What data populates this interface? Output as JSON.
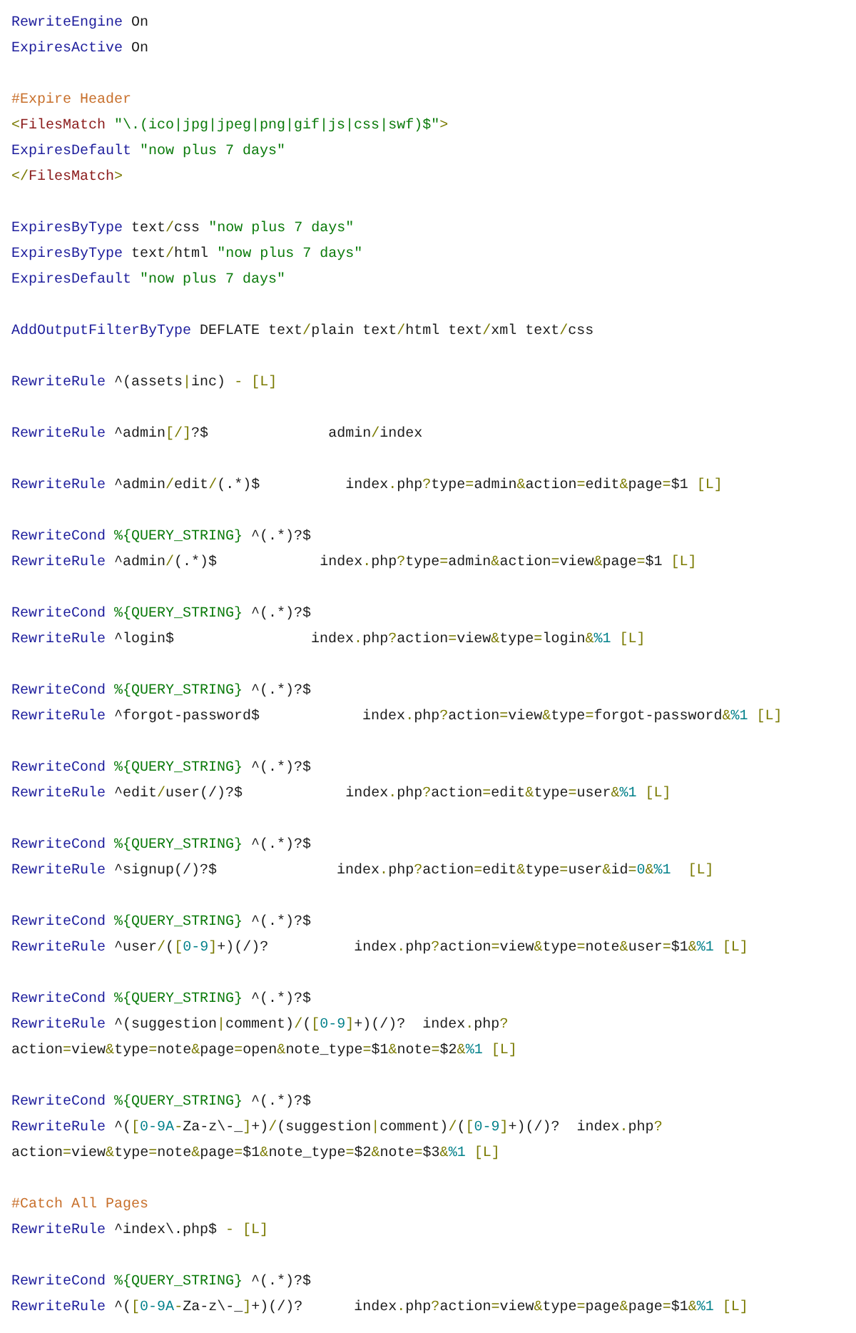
{
  "blocks": [
    {
      "lines": [
        {
          "tokens": [
            {
              "kind": "directive",
              "text": "RewriteEngine"
            },
            {
              "kind": "plain",
              "text": " On"
            }
          ]
        },
        {
          "tokens": [
            {
              "kind": "directive",
              "text": "ExpiresActive"
            },
            {
              "kind": "plain",
              "text": " On"
            }
          ]
        }
      ]
    },
    {
      "lines": [
        {
          "tokens": [
            {
              "kind": "comment",
              "text": "#Expire Header"
            }
          ]
        },
        {
          "tokens": [
            {
              "kind": "tag",
              "text": "<"
            },
            {
              "kind": "tagname",
              "text": "FilesMatch"
            },
            {
              "kind": "string",
              "text": " \"\\.(ico|jpg|jpeg|png|gif|js|css|swf)$\""
            },
            {
              "kind": "tag",
              "text": ">"
            }
          ]
        },
        {
          "tokens": [
            {
              "kind": "directive",
              "text": "ExpiresDefault"
            },
            {
              "kind": "string",
              "text": " \"now plus 7 days\""
            }
          ]
        },
        {
          "tokens": [
            {
              "kind": "tag",
              "text": "</"
            },
            {
              "kind": "tagname",
              "text": "FilesMatch"
            },
            {
              "kind": "tag",
              "text": ">"
            }
          ]
        }
      ]
    },
    {
      "lines": [
        {
          "tokens": [
            {
              "kind": "directive",
              "text": "ExpiresByType"
            },
            {
              "kind": "plain",
              "text": " text"
            },
            {
              "kind": "op",
              "text": "/"
            },
            {
              "kind": "plain",
              "text": "css"
            },
            {
              "kind": "string",
              "text": " \"now plus 7 days\""
            }
          ]
        },
        {
          "tokens": [
            {
              "kind": "directive",
              "text": "ExpiresByType"
            },
            {
              "kind": "plain",
              "text": " text"
            },
            {
              "kind": "op",
              "text": "/"
            },
            {
              "kind": "plain",
              "text": "html"
            },
            {
              "kind": "string",
              "text": " \"now plus 7 days\""
            }
          ]
        },
        {
          "tokens": [
            {
              "kind": "directive",
              "text": "ExpiresDefault"
            },
            {
              "kind": "string",
              "text": " \"now plus 7 days\""
            }
          ]
        }
      ]
    },
    {
      "lines": [
        {
          "tokens": [
            {
              "kind": "directive",
              "text": "AddOutputFilterByType"
            },
            {
              "kind": "plain",
              "text": " DEFLATE text"
            },
            {
              "kind": "op",
              "text": "/"
            },
            {
              "kind": "plain",
              "text": "plain text"
            },
            {
              "kind": "op",
              "text": "/"
            },
            {
              "kind": "plain",
              "text": "html text"
            },
            {
              "kind": "op",
              "text": "/"
            },
            {
              "kind": "plain",
              "text": "xml text"
            },
            {
              "kind": "op",
              "text": "/"
            },
            {
              "kind": "plain",
              "text": "css"
            }
          ]
        }
      ]
    },
    {
      "lines": [
        {
          "tokens": [
            {
              "kind": "directive",
              "text": "RewriteRule"
            },
            {
              "kind": "plain",
              "text": " ^(assets"
            },
            {
              "kind": "op",
              "text": "|"
            },
            {
              "kind": "plain",
              "text": "inc)"
            },
            {
              "kind": "op",
              "text": " - [L]"
            }
          ]
        }
      ]
    },
    {
      "lines": [
        {
          "tokens": [
            {
              "kind": "directive",
              "text": "RewriteRule"
            },
            {
              "kind": "plain",
              "text": " ^admin"
            },
            {
              "kind": "op",
              "text": "[/]"
            },
            {
              "kind": "plain",
              "text": "?$              admin"
            },
            {
              "kind": "op",
              "text": "/"
            },
            {
              "kind": "plain",
              "text": "index"
            }
          ]
        }
      ]
    },
    {
      "lines": [
        {
          "tokens": [
            {
              "kind": "directive",
              "text": "RewriteRule"
            },
            {
              "kind": "plain",
              "text": " ^admin"
            },
            {
              "kind": "op",
              "text": "/"
            },
            {
              "kind": "plain",
              "text": "edit"
            },
            {
              "kind": "op",
              "text": "/"
            },
            {
              "kind": "plain",
              "text": "(.*)$          index"
            },
            {
              "kind": "op",
              "text": "."
            },
            {
              "kind": "plain",
              "text": "php"
            },
            {
              "kind": "op",
              "text": "?"
            },
            {
              "kind": "plain",
              "text": "type"
            },
            {
              "kind": "op",
              "text": "="
            },
            {
              "kind": "plain",
              "text": "admin"
            },
            {
              "kind": "op",
              "text": "&"
            },
            {
              "kind": "plain",
              "text": "action"
            },
            {
              "kind": "op",
              "text": "="
            },
            {
              "kind": "plain",
              "text": "edit"
            },
            {
              "kind": "op",
              "text": "&"
            },
            {
              "kind": "plain",
              "text": "page"
            },
            {
              "kind": "op",
              "text": "="
            },
            {
              "kind": "plain",
              "text": "$1"
            },
            {
              "kind": "op",
              "text": " [L]"
            }
          ]
        }
      ]
    },
    {
      "lines": [
        {
          "tokens": [
            {
              "kind": "directive",
              "text": "RewriteCond"
            },
            {
              "kind": "string",
              "text": " %{QUERY_STRING}"
            },
            {
              "kind": "plain",
              "text": " ^(.*)?$"
            }
          ]
        },
        {
          "tokens": [
            {
              "kind": "directive",
              "text": "RewriteRule"
            },
            {
              "kind": "plain",
              "text": " ^admin"
            },
            {
              "kind": "op",
              "text": "/"
            },
            {
              "kind": "plain",
              "text": "(.*)$            index"
            },
            {
              "kind": "op",
              "text": "."
            },
            {
              "kind": "plain",
              "text": "php"
            },
            {
              "kind": "op",
              "text": "?"
            },
            {
              "kind": "plain",
              "text": "type"
            },
            {
              "kind": "op",
              "text": "="
            },
            {
              "kind": "plain",
              "text": "admin"
            },
            {
              "kind": "op",
              "text": "&"
            },
            {
              "kind": "plain",
              "text": "action"
            },
            {
              "kind": "op",
              "text": "="
            },
            {
              "kind": "plain",
              "text": "view"
            },
            {
              "kind": "op",
              "text": "&"
            },
            {
              "kind": "plain",
              "text": "page"
            },
            {
              "kind": "op",
              "text": "="
            },
            {
              "kind": "plain",
              "text": "$1"
            },
            {
              "kind": "op",
              "text": " [L]"
            }
          ]
        }
      ]
    },
    {
      "lines": [
        {
          "tokens": [
            {
              "kind": "directive",
              "text": "RewriteCond"
            },
            {
              "kind": "string",
              "text": " %{QUERY_STRING}"
            },
            {
              "kind": "plain",
              "text": " ^(.*)?$"
            }
          ]
        },
        {
          "tokens": [
            {
              "kind": "directive",
              "text": "RewriteRule"
            },
            {
              "kind": "plain",
              "text": " ^login$                index"
            },
            {
              "kind": "op",
              "text": "."
            },
            {
              "kind": "plain",
              "text": "php"
            },
            {
              "kind": "op",
              "text": "?"
            },
            {
              "kind": "plain",
              "text": "action"
            },
            {
              "kind": "op",
              "text": "="
            },
            {
              "kind": "plain",
              "text": "view"
            },
            {
              "kind": "op",
              "text": "&"
            },
            {
              "kind": "plain",
              "text": "type"
            },
            {
              "kind": "op",
              "text": "="
            },
            {
              "kind": "plain",
              "text": "login"
            },
            {
              "kind": "op",
              "text": "&"
            },
            {
              "kind": "number",
              "text": "%1"
            },
            {
              "kind": "op",
              "text": " [L]"
            }
          ]
        }
      ]
    },
    {
      "lines": [
        {
          "tokens": [
            {
              "kind": "directive",
              "text": "RewriteCond"
            },
            {
              "kind": "string",
              "text": " %{QUERY_STRING}"
            },
            {
              "kind": "plain",
              "text": " ^(.*)?$"
            }
          ]
        },
        {
          "tokens": [
            {
              "kind": "directive",
              "text": "RewriteRule"
            },
            {
              "kind": "plain",
              "text": " ^forgot-password$            index"
            },
            {
              "kind": "op",
              "text": "."
            },
            {
              "kind": "plain",
              "text": "php"
            },
            {
              "kind": "op",
              "text": "?"
            },
            {
              "kind": "plain",
              "text": "action"
            },
            {
              "kind": "op",
              "text": "="
            },
            {
              "kind": "plain",
              "text": "view"
            },
            {
              "kind": "op",
              "text": "&"
            },
            {
              "kind": "plain",
              "text": "type"
            },
            {
              "kind": "op",
              "text": "="
            },
            {
              "kind": "plain",
              "text": "forgot-password"
            },
            {
              "kind": "op",
              "text": "&"
            },
            {
              "kind": "number",
              "text": "%1"
            },
            {
              "kind": "op",
              "text": " [L]"
            }
          ]
        }
      ]
    },
    {
      "lines": [
        {
          "tokens": [
            {
              "kind": "directive",
              "text": "RewriteCond"
            },
            {
              "kind": "string",
              "text": " %{QUERY_STRING}"
            },
            {
              "kind": "plain",
              "text": " ^(.*)?$"
            }
          ]
        },
        {
          "tokens": [
            {
              "kind": "directive",
              "text": "RewriteRule"
            },
            {
              "kind": "plain",
              "text": " ^edit"
            },
            {
              "kind": "op",
              "text": "/"
            },
            {
              "kind": "plain",
              "text": "user(/)?$            index"
            },
            {
              "kind": "op",
              "text": "."
            },
            {
              "kind": "plain",
              "text": "php"
            },
            {
              "kind": "op",
              "text": "?"
            },
            {
              "kind": "plain",
              "text": "action"
            },
            {
              "kind": "op",
              "text": "="
            },
            {
              "kind": "plain",
              "text": "edit"
            },
            {
              "kind": "op",
              "text": "&"
            },
            {
              "kind": "plain",
              "text": "type"
            },
            {
              "kind": "op",
              "text": "="
            },
            {
              "kind": "plain",
              "text": "user"
            },
            {
              "kind": "op",
              "text": "&"
            },
            {
              "kind": "number",
              "text": "%1"
            },
            {
              "kind": "op",
              "text": " [L]"
            }
          ]
        }
      ]
    },
    {
      "lines": [
        {
          "tokens": [
            {
              "kind": "directive",
              "text": "RewriteCond"
            },
            {
              "kind": "string",
              "text": " %{QUERY_STRING}"
            },
            {
              "kind": "plain",
              "text": " ^(.*)?$"
            }
          ]
        },
        {
          "tokens": [
            {
              "kind": "directive",
              "text": "RewriteRule"
            },
            {
              "kind": "plain",
              "text": " ^signup(/)?$              index"
            },
            {
              "kind": "op",
              "text": "."
            },
            {
              "kind": "plain",
              "text": "php"
            },
            {
              "kind": "op",
              "text": "?"
            },
            {
              "kind": "plain",
              "text": "action"
            },
            {
              "kind": "op",
              "text": "="
            },
            {
              "kind": "plain",
              "text": "edit"
            },
            {
              "kind": "op",
              "text": "&"
            },
            {
              "kind": "plain",
              "text": "type"
            },
            {
              "kind": "op",
              "text": "="
            },
            {
              "kind": "plain",
              "text": "user"
            },
            {
              "kind": "op",
              "text": "&"
            },
            {
              "kind": "plain",
              "text": "id"
            },
            {
              "kind": "op",
              "text": "="
            },
            {
              "kind": "number",
              "text": "0"
            },
            {
              "kind": "op",
              "text": "&"
            },
            {
              "kind": "number",
              "text": "%1"
            },
            {
              "kind": "op",
              "text": "  [L]"
            }
          ]
        }
      ]
    },
    {
      "lines": [
        {
          "tokens": [
            {
              "kind": "directive",
              "text": "RewriteCond"
            },
            {
              "kind": "string",
              "text": " %{QUERY_STRING}"
            },
            {
              "kind": "plain",
              "text": " ^(.*)?$"
            }
          ]
        },
        {
          "tokens": [
            {
              "kind": "directive",
              "text": "RewriteRule"
            },
            {
              "kind": "plain",
              "text": " ^user"
            },
            {
              "kind": "op",
              "text": "/"
            },
            {
              "kind": "plain",
              "text": "("
            },
            {
              "kind": "op",
              "text": "["
            },
            {
              "kind": "number",
              "text": "0-9"
            },
            {
              "kind": "op",
              "text": "]"
            },
            {
              "kind": "plain",
              "text": "+)(/)?          index"
            },
            {
              "kind": "op",
              "text": "."
            },
            {
              "kind": "plain",
              "text": "php"
            },
            {
              "kind": "op",
              "text": "?"
            },
            {
              "kind": "plain",
              "text": "action"
            },
            {
              "kind": "op",
              "text": "="
            },
            {
              "kind": "plain",
              "text": "view"
            },
            {
              "kind": "op",
              "text": "&"
            },
            {
              "kind": "plain",
              "text": "type"
            },
            {
              "kind": "op",
              "text": "="
            },
            {
              "kind": "plain",
              "text": "note"
            },
            {
              "kind": "op",
              "text": "&"
            },
            {
              "kind": "plain",
              "text": "user"
            },
            {
              "kind": "op",
              "text": "="
            },
            {
              "kind": "plain",
              "text": "$1"
            },
            {
              "kind": "op",
              "text": "&"
            },
            {
              "kind": "number",
              "text": "%1"
            },
            {
              "kind": "op",
              "text": " [L]"
            }
          ]
        }
      ]
    },
    {
      "lines": [
        {
          "tokens": [
            {
              "kind": "directive",
              "text": "RewriteCond"
            },
            {
              "kind": "string",
              "text": " %{QUERY_STRING}"
            },
            {
              "kind": "plain",
              "text": " ^(.*)?$"
            }
          ]
        },
        {
          "tokens": [
            {
              "kind": "directive",
              "text": "RewriteRule"
            },
            {
              "kind": "plain",
              "text": " ^(suggestion"
            },
            {
              "kind": "op",
              "text": "|"
            },
            {
              "kind": "plain",
              "text": "comment)"
            },
            {
              "kind": "op",
              "text": "/"
            },
            {
              "kind": "plain",
              "text": "("
            },
            {
              "kind": "op",
              "text": "["
            },
            {
              "kind": "number",
              "text": "0-9"
            },
            {
              "kind": "op",
              "text": "]"
            },
            {
              "kind": "plain",
              "text": "+)(/)?  index"
            },
            {
              "kind": "op",
              "text": "."
            },
            {
              "kind": "plain",
              "text": "php"
            },
            {
              "kind": "op",
              "text": "?"
            }
          ]
        },
        {
          "tokens": [
            {
              "kind": "plain",
              "text": "action"
            },
            {
              "kind": "op",
              "text": "="
            },
            {
              "kind": "plain",
              "text": "view"
            },
            {
              "kind": "op",
              "text": "&"
            },
            {
              "kind": "plain",
              "text": "type"
            },
            {
              "kind": "op",
              "text": "="
            },
            {
              "kind": "plain",
              "text": "note"
            },
            {
              "kind": "op",
              "text": "&"
            },
            {
              "kind": "plain",
              "text": "page"
            },
            {
              "kind": "op",
              "text": "="
            },
            {
              "kind": "plain",
              "text": "open"
            },
            {
              "kind": "op",
              "text": "&"
            },
            {
              "kind": "plain",
              "text": "note_type"
            },
            {
              "kind": "op",
              "text": "="
            },
            {
              "kind": "plain",
              "text": "$1"
            },
            {
              "kind": "op",
              "text": "&"
            },
            {
              "kind": "plain",
              "text": "note"
            },
            {
              "kind": "op",
              "text": "="
            },
            {
              "kind": "plain",
              "text": "$2"
            },
            {
              "kind": "op",
              "text": "&"
            },
            {
              "kind": "number",
              "text": "%1"
            },
            {
              "kind": "op",
              "text": " [L]"
            }
          ]
        }
      ]
    },
    {
      "lines": [
        {
          "tokens": [
            {
              "kind": "directive",
              "text": "RewriteCond"
            },
            {
              "kind": "string",
              "text": " %{QUERY_STRING}"
            },
            {
              "kind": "plain",
              "text": " ^(.*)?$"
            }
          ]
        },
        {
          "tokens": [
            {
              "kind": "directive",
              "text": "RewriteRule"
            },
            {
              "kind": "plain",
              "text": " ^("
            },
            {
              "kind": "op",
              "text": "["
            },
            {
              "kind": "number",
              "text": "0-9A"
            },
            {
              "kind": "op",
              "text": "-"
            },
            {
              "kind": "plain",
              "text": "Za-z\\-_"
            },
            {
              "kind": "op",
              "text": "]"
            },
            {
              "kind": "plain",
              "text": "+)"
            },
            {
              "kind": "op",
              "text": "/"
            },
            {
              "kind": "plain",
              "text": "(suggestion"
            },
            {
              "kind": "op",
              "text": "|"
            },
            {
              "kind": "plain",
              "text": "comment)"
            },
            {
              "kind": "op",
              "text": "/"
            },
            {
              "kind": "plain",
              "text": "("
            },
            {
              "kind": "op",
              "text": "["
            },
            {
              "kind": "number",
              "text": "0-9"
            },
            {
              "kind": "op",
              "text": "]"
            },
            {
              "kind": "plain",
              "text": "+)(/)?  index"
            },
            {
              "kind": "op",
              "text": "."
            },
            {
              "kind": "plain",
              "text": "php"
            },
            {
              "kind": "op",
              "text": "?"
            }
          ]
        },
        {
          "tokens": [
            {
              "kind": "plain",
              "text": "action"
            },
            {
              "kind": "op",
              "text": "="
            },
            {
              "kind": "plain",
              "text": "view"
            },
            {
              "kind": "op",
              "text": "&"
            },
            {
              "kind": "plain",
              "text": "type"
            },
            {
              "kind": "op",
              "text": "="
            },
            {
              "kind": "plain",
              "text": "note"
            },
            {
              "kind": "op",
              "text": "&"
            },
            {
              "kind": "plain",
              "text": "page"
            },
            {
              "kind": "op",
              "text": "="
            },
            {
              "kind": "plain",
              "text": "$1"
            },
            {
              "kind": "op",
              "text": "&"
            },
            {
              "kind": "plain",
              "text": "note_type"
            },
            {
              "kind": "op",
              "text": "="
            },
            {
              "kind": "plain",
              "text": "$2"
            },
            {
              "kind": "op",
              "text": "&"
            },
            {
              "kind": "plain",
              "text": "note"
            },
            {
              "kind": "op",
              "text": "="
            },
            {
              "kind": "plain",
              "text": "$3"
            },
            {
              "kind": "op",
              "text": "&"
            },
            {
              "kind": "number",
              "text": "%1"
            },
            {
              "kind": "op",
              "text": " [L]"
            }
          ]
        }
      ]
    },
    {
      "lines": [
        {
          "tokens": [
            {
              "kind": "comment",
              "text": "#Catch All Pages"
            }
          ]
        },
        {
          "tokens": [
            {
              "kind": "directive",
              "text": "RewriteRule"
            },
            {
              "kind": "plain",
              "text": " ^index\\.php$"
            },
            {
              "kind": "op",
              "text": " - [L]"
            }
          ]
        }
      ]
    },
    {
      "lines": [
        {
          "tokens": [
            {
              "kind": "directive",
              "text": "RewriteCond"
            },
            {
              "kind": "string",
              "text": " %{QUERY_STRING}"
            },
            {
              "kind": "plain",
              "text": " ^(.*)?$"
            }
          ]
        },
        {
          "tokens": [
            {
              "kind": "directive",
              "text": "RewriteRule"
            },
            {
              "kind": "plain",
              "text": " ^("
            },
            {
              "kind": "op",
              "text": "["
            },
            {
              "kind": "number",
              "text": "0-9A"
            },
            {
              "kind": "op",
              "text": "-"
            },
            {
              "kind": "plain",
              "text": "Za-z\\-_"
            },
            {
              "kind": "op",
              "text": "]"
            },
            {
              "kind": "plain",
              "text": "+)(/)?      index"
            },
            {
              "kind": "op",
              "text": "."
            },
            {
              "kind": "plain",
              "text": "php"
            },
            {
              "kind": "op",
              "text": "?"
            },
            {
              "kind": "plain",
              "text": "action"
            },
            {
              "kind": "op",
              "text": "="
            },
            {
              "kind": "plain",
              "text": "view"
            },
            {
              "kind": "op",
              "text": "&"
            },
            {
              "kind": "plain",
              "text": "type"
            },
            {
              "kind": "op",
              "text": "="
            },
            {
              "kind": "plain",
              "text": "page"
            },
            {
              "kind": "op",
              "text": "&"
            },
            {
              "kind": "plain",
              "text": "page"
            },
            {
              "kind": "op",
              "text": "="
            },
            {
              "kind": "plain",
              "text": "$1"
            },
            {
              "kind": "op",
              "text": "&"
            },
            {
              "kind": "number",
              "text": "%1"
            },
            {
              "kind": "op",
              "text": " [L]"
            }
          ]
        }
      ]
    }
  ]
}
